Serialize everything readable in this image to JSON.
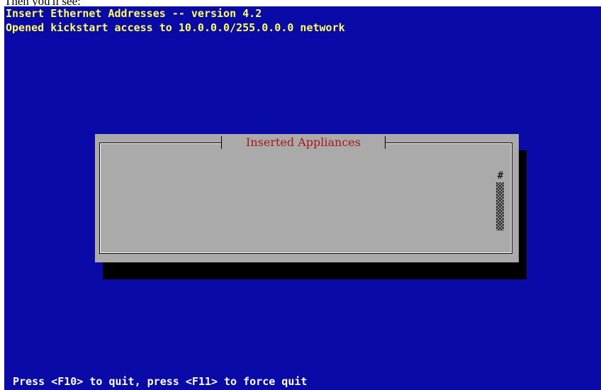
{
  "caption": "Then you'll see:",
  "terminal": {
    "title": "Insert Ethernet Addresses -- version 4.2",
    "subtitle": "Opened kickstart access to 10.0.0.0/255.0.0.0 network",
    "footer": "Press <F10> to quit, press <F11> to force quit"
  },
  "dialog": {
    "title": "Inserted Appliances",
    "items": [],
    "scroll_indicator": "#",
    "scroll_position": 0.0
  },
  "colors": {
    "screen_bg": "#0a0aa8",
    "header_text": "#ffff55",
    "footer_text": "#ffffff",
    "dialog_bg": "#aaaaaa",
    "dialog_title": "#a81818",
    "shadow": "#000000"
  }
}
